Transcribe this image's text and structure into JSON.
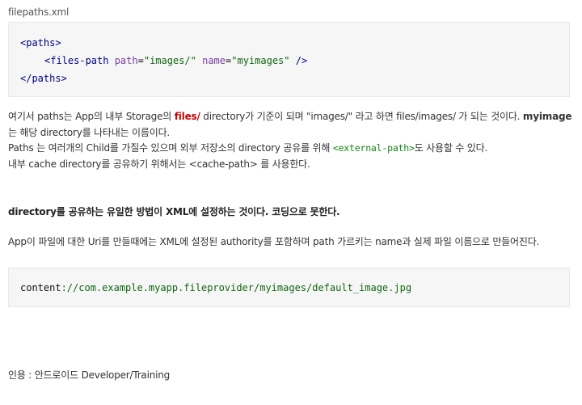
{
  "file_label": "filepaths.xml",
  "code1": {
    "line1": "<paths>",
    "line2": {
      "open": "<files-path ",
      "attr1": "path",
      "eq1": "=",
      "val1": "\"images/\"",
      "attr2": "name",
      "eq2": "=",
      "val2": "\"myimages\"",
      "close": " />"
    },
    "line3": "</paths>"
  },
  "para1": {
    "a": "여기서 paths는 App의 내부 Storage의 ",
    "b": "files/",
    "c": " directory가 기준이 되며 \"images/\" 라고 하면 files/images/ 가 되는 것이다. ",
    "d": "myimage",
    "e": "는 해당 directory를 나타내는 이름이다.",
    "f": "Paths 는 여러개의 Child를 가질수 있으며 외부 저장소의 directory 공유를 위해 ",
    "g": "<external-path>",
    "h": "도  사용할 수 있다.",
    "i": "내부 cache directory를 공유하기 위해서는 <cache-path> 를 사용한다."
  },
  "para2": "directory를 공유하는 유일한 방법이 XML에 설정하는 것이다. 코딩으로 못한다.",
  "para3": "App이 파일에 대한 Uri를 만들때에는 XML에 설정된 authority를 포함하며 path 가르키는 name과 실제 파일 이름으로 만들어진다.",
  "code2": {
    "label": "content",
    "value": "://com.example.myapp.fileprovider/myimages/default_image.jpg"
  },
  "citation": "인용 : 안드로이드 Developer/Training"
}
